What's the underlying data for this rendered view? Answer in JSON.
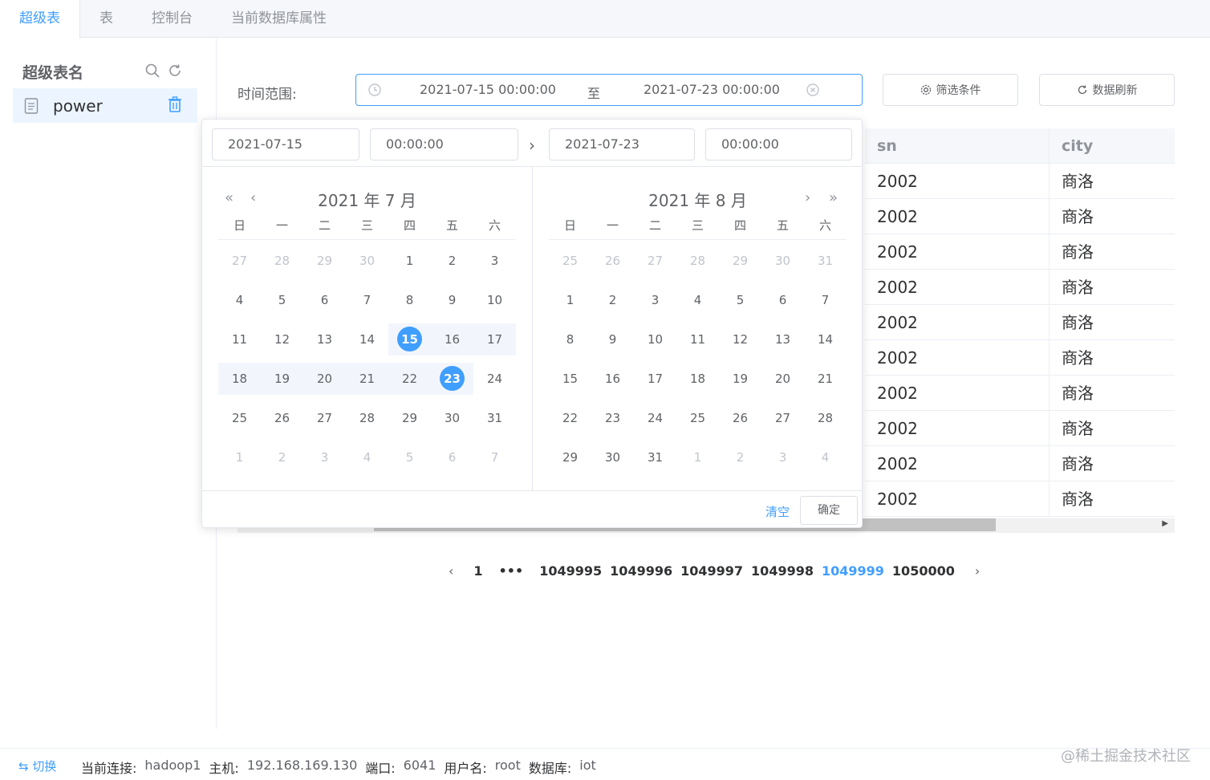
{
  "tabs": [
    "超级表",
    "表",
    "控制台",
    "当前数据库属性"
  ],
  "sidebar": {
    "heading": "超级表名",
    "items": [
      {
        "label": "power"
      }
    ]
  },
  "filter": {
    "label": "时间范围:",
    "start": "2021-07-15 00:00:00",
    "separator": "至",
    "end": "2021-07-23 00:00:00",
    "filter_button": "筛选条件",
    "refresh_button": "数据刷新"
  },
  "picker": {
    "start_date": "2021-07-15",
    "start_time": "00:00:00",
    "end_date": "2021-07-23",
    "end_time": "00:00:00",
    "weekdays": [
      "日",
      "一",
      "二",
      "三",
      "四",
      "五",
      "六"
    ],
    "left": {
      "title": "2021 年 7 月",
      "days": [
        [
          "27",
          "28",
          "29",
          "30",
          "1",
          "2",
          "3"
        ],
        [
          "4",
          "5",
          "6",
          "7",
          "8",
          "9",
          "10"
        ],
        [
          "11",
          "12",
          "13",
          "14",
          "15",
          "16",
          "17"
        ],
        [
          "18",
          "19",
          "20",
          "21",
          "22",
          "23",
          "24"
        ],
        [
          "25",
          "26",
          "27",
          "28",
          "29",
          "30",
          "31"
        ],
        [
          "1",
          "2",
          "3",
          "4",
          "5",
          "6",
          "7"
        ]
      ]
    },
    "right": {
      "title": "2021 年 8 月",
      "days": [
        [
          "25",
          "26",
          "27",
          "28",
          "29",
          "30",
          "31"
        ],
        [
          "1",
          "2",
          "3",
          "4",
          "5",
          "6",
          "7"
        ],
        [
          "8",
          "9",
          "10",
          "11",
          "12",
          "13",
          "14"
        ],
        [
          "15",
          "16",
          "17",
          "18",
          "19",
          "20",
          "21"
        ],
        [
          "22",
          "23",
          "24",
          "25",
          "26",
          "27",
          "28"
        ],
        [
          "29",
          "30",
          "31",
          "1",
          "2",
          "3",
          "4"
        ]
      ]
    },
    "selected_start": "15",
    "selected_end": "23",
    "clear_label": "清空",
    "confirm_label": "确定"
  },
  "table": {
    "columns": [
      "sn",
      "city"
    ],
    "rows": [
      [
        "2002",
        "商洛"
      ],
      [
        "2002",
        "商洛"
      ],
      [
        "2002",
        "商洛"
      ],
      [
        "2002",
        "商洛"
      ],
      [
        "2002",
        "商洛"
      ],
      [
        "2002",
        "商洛"
      ],
      [
        "2002",
        "商洛"
      ],
      [
        "2002",
        "商洛"
      ],
      [
        "2002",
        "商洛"
      ],
      [
        "2002",
        "商洛"
      ]
    ]
  },
  "pagination": {
    "prev": "‹",
    "next": "›",
    "pages": [
      "1",
      "•••",
      "1049995",
      "1049996",
      "1049997",
      "1049998",
      "1049999",
      "1050000"
    ],
    "current": "1049999"
  },
  "status": {
    "switch_label": "⇆ 切换",
    "items": [
      {
        "key": "当前连接:",
        "value": "hadoop1"
      },
      {
        "key": "主机:",
        "value": "192.168.169.130"
      },
      {
        "key": "端口:",
        "value": "6041"
      },
      {
        "key": "用户名:",
        "value": "root"
      },
      {
        "key": "数据库:",
        "value": "iot"
      }
    ]
  },
  "watermark": "@稀土掘金技术社区",
  "colors": {
    "accent": "#409eff",
    "range_bg": "#f2f6fc"
  }
}
